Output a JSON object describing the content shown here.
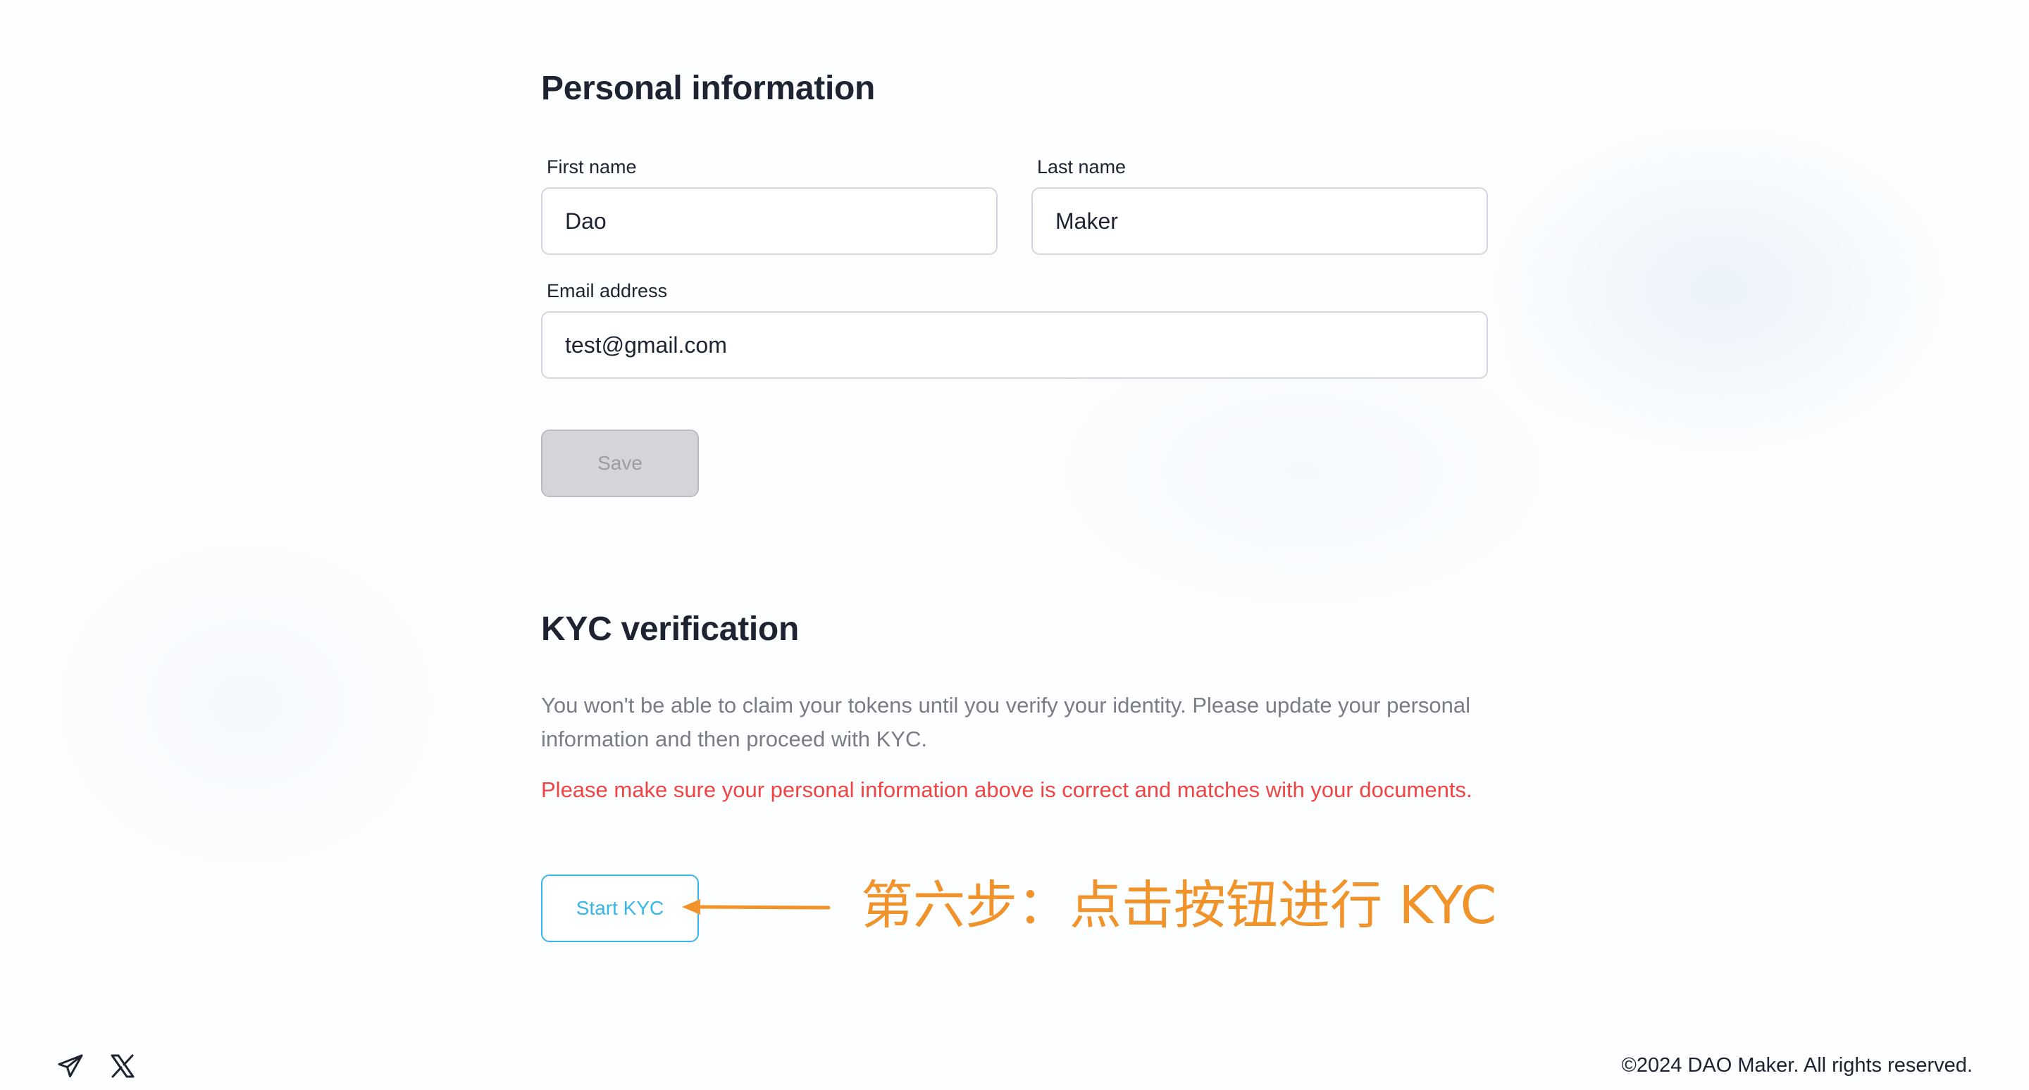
{
  "personal_section": {
    "title": "Personal information",
    "first_name": {
      "label": "First name",
      "value": "Dao"
    },
    "last_name": {
      "label": "Last name",
      "value": "Maker"
    },
    "email": {
      "label": "Email address",
      "value": "test@gmail.com"
    },
    "save_label": "Save"
  },
  "kyc_section": {
    "title": "KYC verification",
    "description": "You won't be able to claim your tokens until you verify your identity. Please update your personal information and then proceed with KYC.",
    "warning": "Please make sure your personal information above is correct and matches with your documents.",
    "start_label": "Start KYC"
  },
  "annotation": {
    "text": "第六步：点击按钮进行 KYC",
    "color": "#f0932b"
  },
  "footer": {
    "icons": [
      "telegram-icon",
      "x-icon"
    ],
    "copyright": "©2024 DAO Maker. All rights reserved."
  },
  "colors": {
    "accent": "#38b6ea",
    "warning": "#ef4444",
    "disabled_button": "#d3d5d8"
  }
}
